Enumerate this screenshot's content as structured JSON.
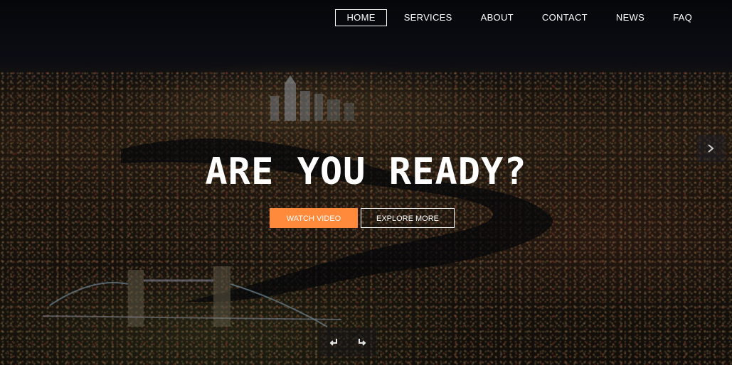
{
  "nav": {
    "items": [
      {
        "label": "HOME",
        "active": true
      },
      {
        "label": "SERVICES",
        "active": false
      },
      {
        "label": "ABOUT",
        "active": false
      },
      {
        "label": "CONTACT",
        "active": false
      },
      {
        "label": "NEWS",
        "active": false
      },
      {
        "label": "FAQ",
        "active": false
      }
    ]
  },
  "hero": {
    "headline": "ARE YOU READY?",
    "primary_cta": "WATCH VIDEO",
    "secondary_cta": "EXPLORE MORE"
  },
  "icons": {
    "next": "chevron-right-icon",
    "prev_control": "turn-left-icon",
    "next_control": "turn-right-icon"
  },
  "colors": {
    "accent": "#ff8a3c",
    "text": "#ffffff"
  }
}
